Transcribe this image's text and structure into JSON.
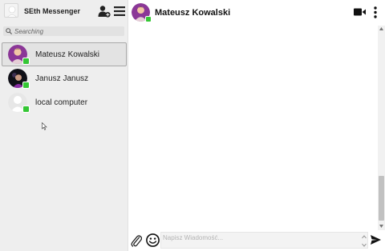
{
  "app": {
    "title": "SEth Messenger"
  },
  "search": {
    "placeholder": "Searching"
  },
  "contacts": [
    {
      "name": "Mateusz Kowalski",
      "status": "online",
      "active": true,
      "avatar": "purple-portrait"
    },
    {
      "name": "Janusz Janusz",
      "status": "online",
      "active": false,
      "avatar": "dark-portrait"
    },
    {
      "name": "local computer",
      "status": "online",
      "active": false,
      "avatar": "default-silhouette"
    }
  ],
  "chat": {
    "contact_name": "Mateusz Kowalski",
    "status": "online",
    "message_placeholder": "Napisz Wiadomość..."
  },
  "icons": {
    "header": [
      "add-user-icon",
      "menu-icon"
    ],
    "chat_header": [
      "video-camera-icon",
      "more-vertical-icon"
    ],
    "composer": [
      "paperclip-icon",
      "emoji-icon",
      "send-icon"
    ]
  },
  "colors": {
    "online": "#35c635",
    "sidebar_bg": "#eeeeee",
    "active_border": "#a9a9a9"
  }
}
